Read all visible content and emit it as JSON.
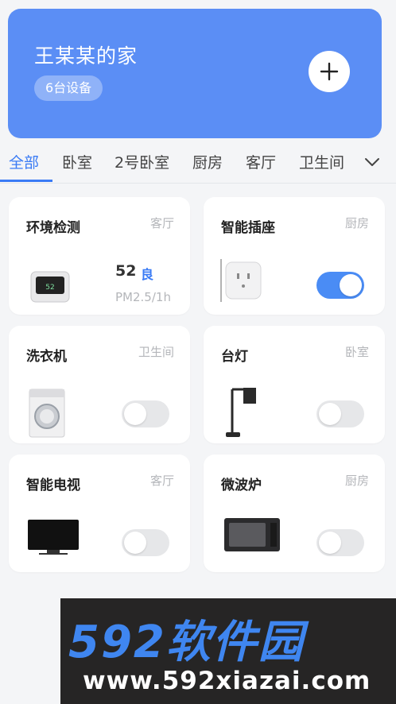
{
  "header": {
    "home_title": "王某某的家",
    "device_count": "6台设备"
  },
  "tabs": [
    {
      "label": "全部",
      "active": true
    },
    {
      "label": "卧室"
    },
    {
      "label": "2号卧室"
    },
    {
      "label": "厨房"
    },
    {
      "label": "客厅"
    },
    {
      "label": "卫生间"
    }
  ],
  "devices": [
    {
      "name": "环境检测",
      "room": "客厅",
      "aqi_value": "52",
      "aqi_level": "良",
      "aqi_unit": "PM2.5/1h"
    },
    {
      "name": "智能插座",
      "room": "厨房",
      "toggle_on": true
    },
    {
      "name": "洗衣机",
      "room": "卫生间",
      "toggle_on": false
    },
    {
      "name": "台灯",
      "room": "卧室",
      "toggle_on": false
    },
    {
      "name": "智能电视",
      "room": "客厅",
      "toggle_on": false
    },
    {
      "name": "微波炉",
      "room": "厨房",
      "toggle_on": false
    }
  ],
  "watermark": {
    "logo": "592软件园",
    "url": "www.592xiazai.com"
  },
  "colors": {
    "accent": "#3a7bf5",
    "header_bg": "#5b8ef5",
    "toggle_on": "#4a8cf5"
  }
}
